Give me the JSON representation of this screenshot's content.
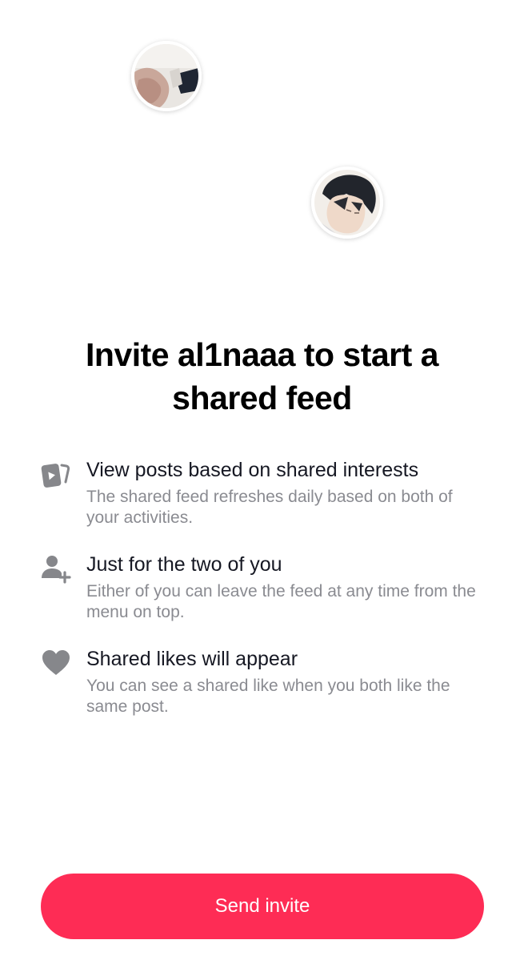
{
  "avatars": [
    {
      "icon": "user-avatar-photo"
    },
    {
      "icon": "friend-avatar-photo"
    }
  ],
  "title": "Invite al1naaa to start a shared feed",
  "features": [
    {
      "icon": "video-cards-icon",
      "title": "View posts based on shared interests",
      "description": "The shared feed refreshes daily based on both of your activities."
    },
    {
      "icon": "person-add-icon",
      "title": "Just for the two of you",
      "description": "Either of you can leave the feed at any time from the menu on top."
    },
    {
      "icon": "heart-icon",
      "title": "Shared likes will appear",
      "description": "You can see a shared like when you both like the same post."
    }
  ],
  "button": {
    "label": "Send invite",
    "color": "#fe2c55"
  },
  "colors": {
    "icon_gray": "#86878b",
    "secondary_text": "#8a8b91"
  }
}
